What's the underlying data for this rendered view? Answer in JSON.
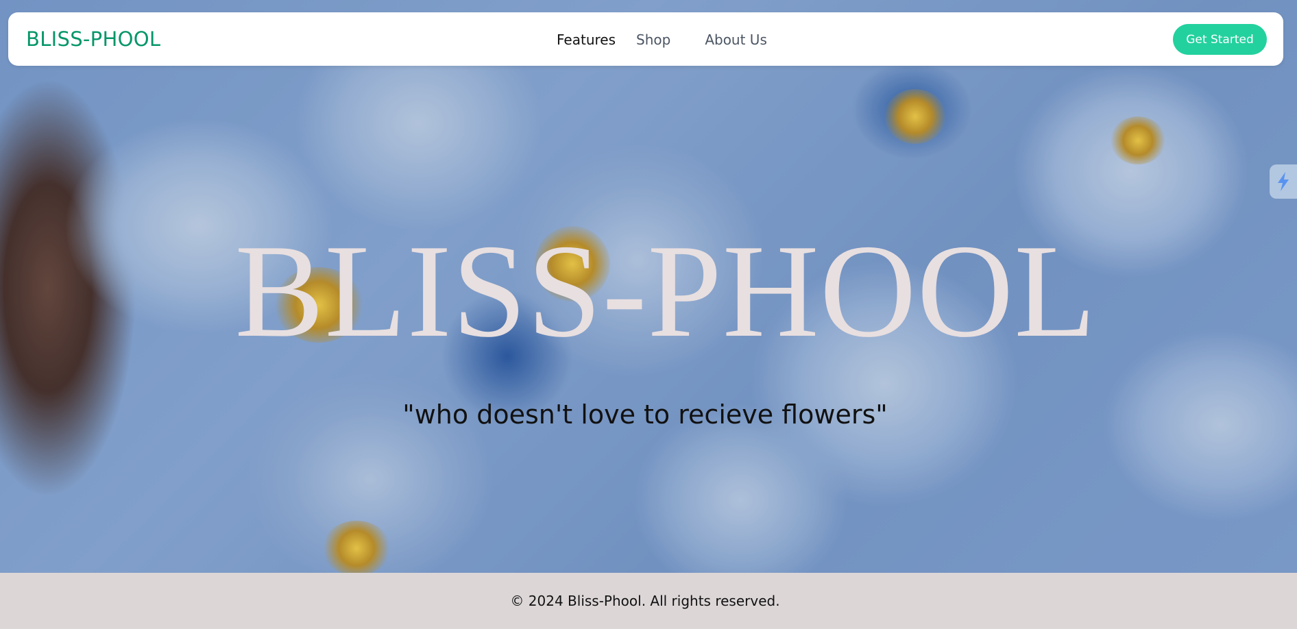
{
  "header": {
    "brand": "BLISS-PHOOL",
    "nav": [
      {
        "label": "Features",
        "active": true
      },
      {
        "label": "Shop",
        "active": false
      },
      {
        "label": "About Us",
        "active": false
      }
    ],
    "cta_label": "Get Started"
  },
  "hero": {
    "title": "BLISS-PHOOL",
    "tagline": "\"who doesn't love to recieve flowers\""
  },
  "footer": {
    "text": "© 2024 Bliss-Phool. All rights reserved."
  },
  "colors": {
    "brand": "#059669",
    "cta_background": "#23d19e",
    "footer_background": "#dcd6d7",
    "hero_title": "#e8dfe0"
  },
  "icons": {
    "side_widget": "lightning-bolt-icon"
  }
}
